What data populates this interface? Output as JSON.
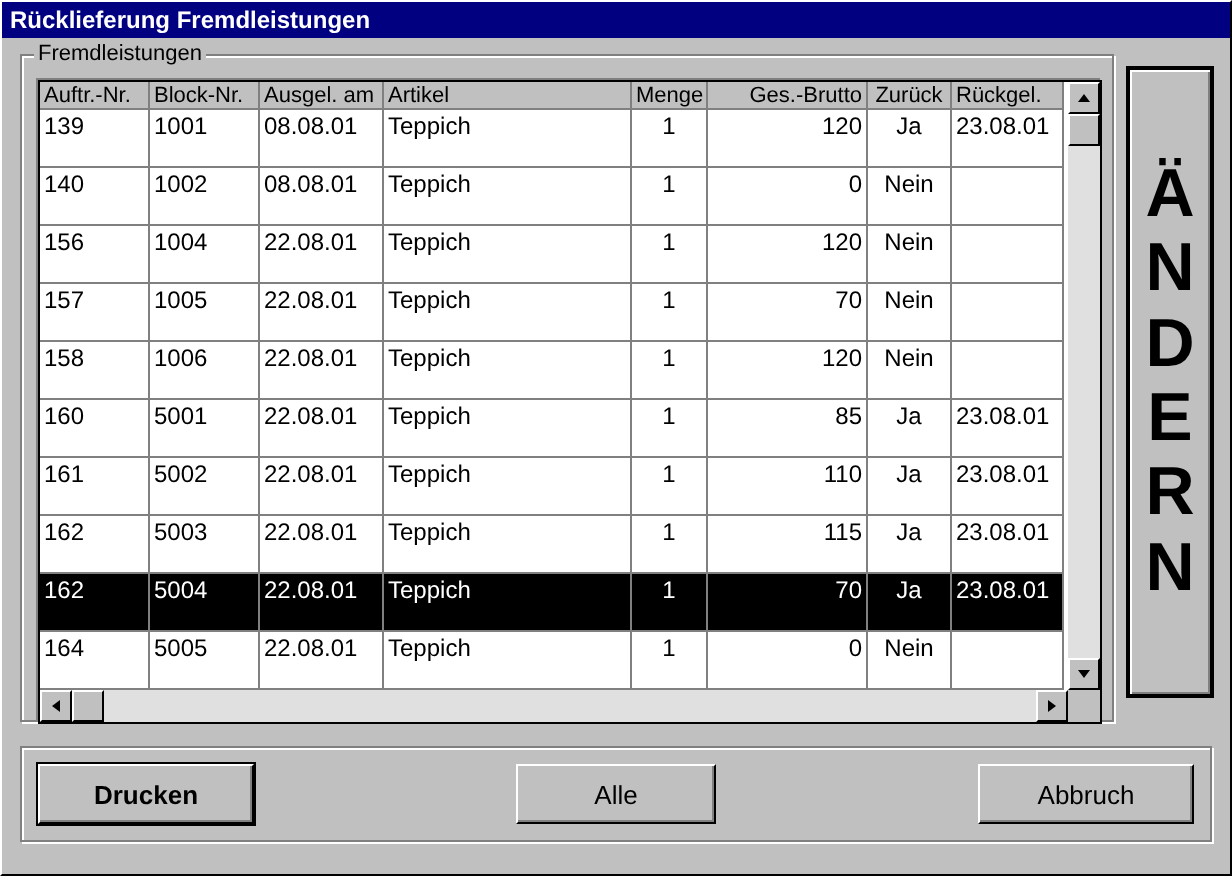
{
  "window": {
    "title": "Rücklieferung Fremdleistungen"
  },
  "group": {
    "label": "Fremdleistungen"
  },
  "table": {
    "columns": [
      "Auftr.-Nr.",
      "Block-Nr.",
      "Ausgel. am",
      "Artikel",
      "Menge",
      "Ges.-Brutto",
      "Zurück",
      "Rückgel."
    ],
    "rows": [
      {
        "selected": false,
        "cells": [
          "139",
          "1001",
          "08.08.01",
          "Teppich",
          "1",
          "120",
          "Ja",
          "23.08.01"
        ]
      },
      {
        "selected": false,
        "cells": [
          "140",
          "1002",
          "08.08.01",
          "Teppich",
          "1",
          "0",
          "Nein",
          ""
        ]
      },
      {
        "selected": false,
        "cells": [
          "156",
          "1004",
          "22.08.01",
          "Teppich",
          "1",
          "120",
          "Nein",
          ""
        ]
      },
      {
        "selected": false,
        "cells": [
          "157",
          "1005",
          "22.08.01",
          "Teppich",
          "1",
          "70",
          "Nein",
          ""
        ]
      },
      {
        "selected": false,
        "cells": [
          "158",
          "1006",
          "22.08.01",
          "Teppich",
          "1",
          "120",
          "Nein",
          ""
        ]
      },
      {
        "selected": false,
        "cells": [
          "160",
          "5001",
          "22.08.01",
          "Teppich",
          "1",
          "85",
          "Ja",
          "23.08.01"
        ]
      },
      {
        "selected": false,
        "cells": [
          "161",
          "5002",
          "22.08.01",
          "Teppich",
          "1",
          "110",
          "Ja",
          "23.08.01"
        ]
      },
      {
        "selected": false,
        "cells": [
          "162",
          "5003",
          "22.08.01",
          "Teppich",
          "1",
          "115",
          "Ja",
          "23.08.01"
        ]
      },
      {
        "selected": true,
        "cells": [
          "162",
          "5004",
          "22.08.01",
          "Teppich",
          "1",
          "70",
          "Ja",
          "23.08.01"
        ]
      },
      {
        "selected": false,
        "cells": [
          "164",
          "5005",
          "22.08.01",
          "Teppich",
          "1",
          "0",
          "Nein",
          ""
        ]
      }
    ]
  },
  "side_button": {
    "label": "ÄNDERN"
  },
  "buttons": [
    {
      "label": "Drucken",
      "default": true
    },
    {
      "label": "Alle",
      "default": false
    },
    {
      "label": "Abbruch",
      "default": false
    }
  ]
}
